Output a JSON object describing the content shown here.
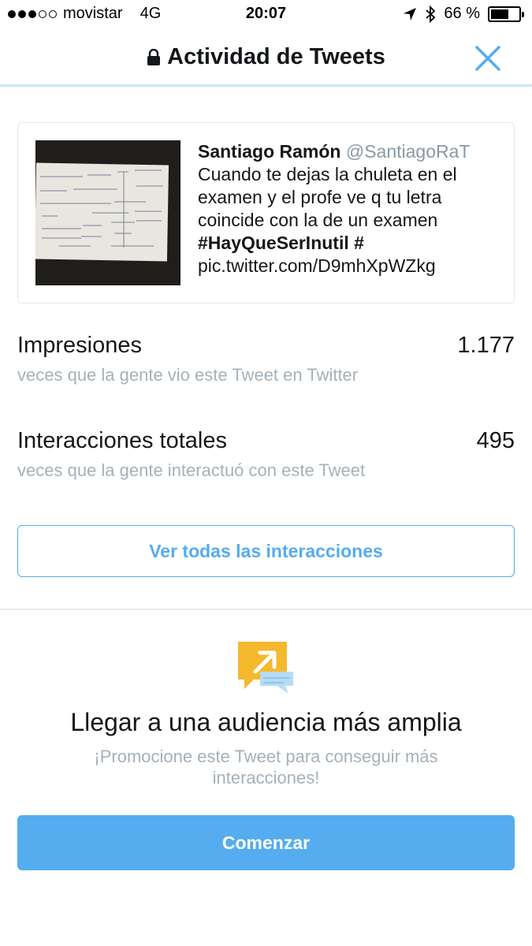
{
  "status_bar": {
    "carrier": "movistar",
    "network": "4G",
    "time": "20:07",
    "battery_percent": "66 %",
    "battery_level": 0.66,
    "signal_bars_filled": 3,
    "signal_bars_total": 5
  },
  "nav": {
    "title": "Actividad de Tweets",
    "lock_icon": "lock-icon",
    "close_icon": "close-icon"
  },
  "tweet": {
    "author_name": "Santiago Ramón",
    "author_handle": "@SantiagoRaT",
    "text": "Cuando te dejas la chuleta en el examen y el profe ve q tu letra coincide con la de un examen",
    "hashtag": "#HayQueSerInutil",
    "hash_symbol": "#",
    "link": "pic.twitter.com/D9mhXpWZkg"
  },
  "stats": {
    "impressions": {
      "label": "Impresiones",
      "value": "1.177",
      "description": "veces que la gente vio este Tweet en Twitter"
    },
    "engagements": {
      "label": "Interacciones totales",
      "value": "495",
      "description": "veces que la gente interactuó con este Tweet"
    }
  },
  "view_all_button": "Ver todas las interacciones",
  "promo": {
    "title": "Llegar a una audiencia más amplia",
    "description": "¡Promocione este Tweet para conseguir más interacciones!",
    "button": "Comenzar"
  },
  "colors": {
    "accent": "#55acee",
    "text": "#14171a",
    "muted": "#a5b1bb",
    "promo_yellow": "#f5b92e",
    "promo_blue_light": "#b7dcf5"
  }
}
